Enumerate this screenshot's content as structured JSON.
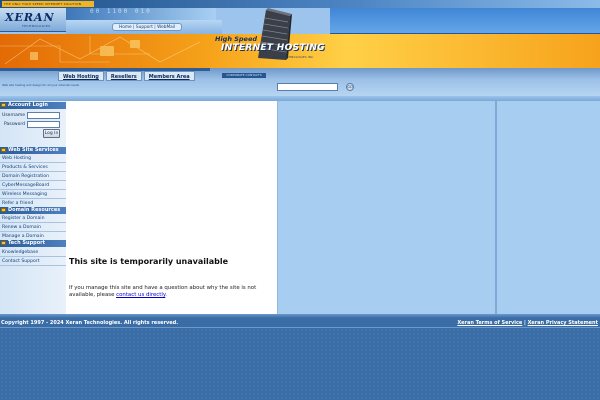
{
  "header": {
    "tagline": "THE ONLY HIGH SPEED INTERNET SOLUTION",
    "logo": "XERAN",
    "logo_sub": "TECHNOLOGIES",
    "digits": "00 1100 010",
    "top_links": [
      "Home",
      "Support",
      "WebMail"
    ],
    "top_links_sep": " | ",
    "headline_1": "High Speed",
    "headline_2": "INTERNET HOSTING",
    "headline_3": "XERAN TECHNOLOGIES INC.",
    "nav_tabs": [
      "Web Hosting",
      "Resellers",
      "Members Area"
    ],
    "nav_label": "CORPORATE CONTACTS",
    "marquee": "Web site hosting and design for all your internet needs",
    "search_placeholder": "",
    "go_label": "GO"
  },
  "sidebar": {
    "account_login": {
      "title": "Account Login",
      "username_label": "Username",
      "password_label": "Password",
      "login_button": "Log In"
    },
    "web_site_services": {
      "title": "Web Site Services",
      "items": [
        "Web Hosting",
        "Products & Services",
        "Domain Registration",
        "CyberMessageBoard",
        "Wireless Messaging",
        "Refer a friend"
      ]
    },
    "domain_resources": {
      "title": "Domain Resources",
      "items": [
        "Register a Domain",
        "Renew a Domain",
        "Manage a Domain"
      ]
    },
    "tech_support": {
      "title": "Tech Support",
      "items": [
        "Knowledgebase",
        "Contact Support"
      ]
    }
  },
  "content": {
    "error_title": "This site is temporarily unavailable",
    "error_msg_before": "If you manage this site and have a question about why the site is not available, please ",
    "error_link": "contact us directly",
    "error_msg_after": "."
  },
  "footer": {
    "copyright": "Copyright 1997 - 2024 Xeran Technologies. All rights reserved.",
    "terms": "Xeran Terms of Service",
    "separator": " | ",
    "privacy": "Xeran Privacy Statement"
  },
  "colors": {
    "header_blue": "#9cc4ec",
    "orange_banner": "#f6a31a",
    "sidebar_header": "#2b5c96",
    "footer_blue": "#3a6ca6",
    "link": "#0000cc"
  }
}
